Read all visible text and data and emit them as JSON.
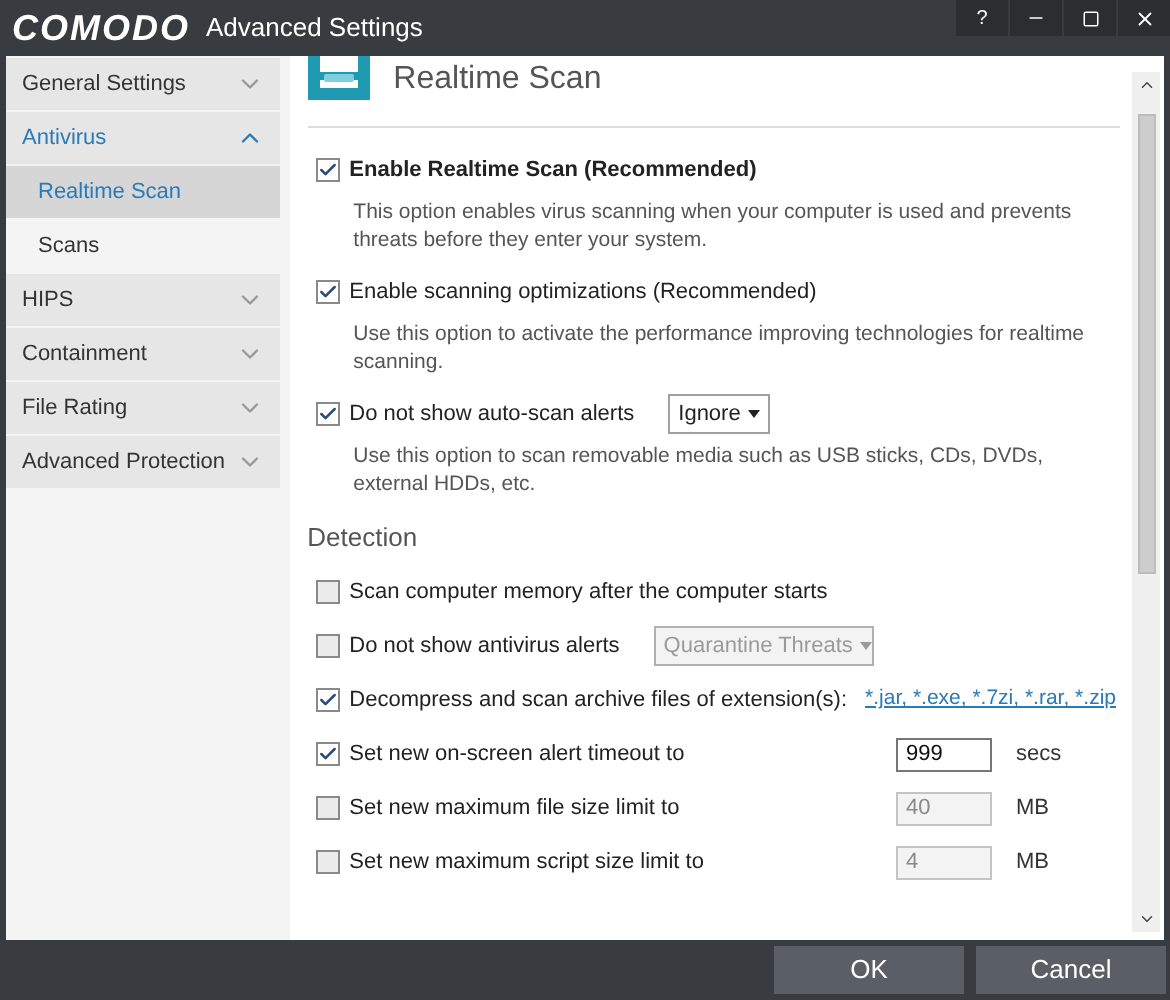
{
  "window": {
    "logo": "COMODO",
    "title": "Advanced Settings",
    "help": "?"
  },
  "sidebar": {
    "items": [
      {
        "label": "General Settings",
        "expanded": false,
        "selected": false
      },
      {
        "label": "Antivirus",
        "expanded": true,
        "selected": true,
        "children": [
          {
            "label": "Realtime Scan",
            "selected": true
          },
          {
            "label": "Scans",
            "selected": false
          }
        ]
      },
      {
        "label": "HIPS",
        "expanded": false,
        "selected": false
      },
      {
        "label": "Containment",
        "expanded": false,
        "selected": false
      },
      {
        "label": "File Rating",
        "expanded": false,
        "selected": false
      },
      {
        "label": "Advanced Protection",
        "expanded": false,
        "selected": false
      }
    ]
  },
  "page": {
    "title": "Realtime Scan",
    "options": [
      {
        "label": "Enable Realtime Scan (Recommended)",
        "checked": true,
        "bold": true,
        "description": "This option enables virus scanning when your computer is used and prevents threats before they enter your system."
      },
      {
        "label": "Enable scanning optimizations (Recommended)",
        "checked": true,
        "bold": false,
        "description": "Use this option to activate the performance improving technologies for realtime scanning."
      },
      {
        "label": "Do not show auto-scan alerts",
        "checked": true,
        "bold": false,
        "dropdown": {
          "value": "Ignore",
          "disabled": false
        },
        "description": "Use this option to scan removable media such as USB sticks, CDs, DVDs, external HDDs, etc."
      }
    ],
    "section": "Detection",
    "detection": [
      {
        "kind": "plain",
        "label": "Scan computer memory after the computer starts",
        "checked": false
      },
      {
        "kind": "dropdown",
        "label": "Do not show antivirus alerts",
        "checked": false,
        "dropdown": {
          "value": "Quarantine Threats",
          "disabled": true
        }
      },
      {
        "kind": "link",
        "label": "Decompress and scan archive files of extension(s):",
        "checked": true,
        "link": "*.jar, *.exe, *.7zi, *.rar, *.zip"
      },
      {
        "kind": "number",
        "label": "Set new on-screen alert timeout to",
        "checked": true,
        "field": {
          "value": "999",
          "disabled": false
        },
        "unit": "secs"
      },
      {
        "kind": "number",
        "label": "Set new maximum file size limit to",
        "checked": false,
        "field": {
          "value": "40",
          "disabled": true
        },
        "unit": "MB"
      },
      {
        "kind": "number",
        "label": "Set new maximum script size limit to",
        "checked": false,
        "field": {
          "value": "4",
          "disabled": true
        },
        "unit": "MB"
      }
    ]
  },
  "buttons": [
    "OK",
    "Cancel"
  ]
}
